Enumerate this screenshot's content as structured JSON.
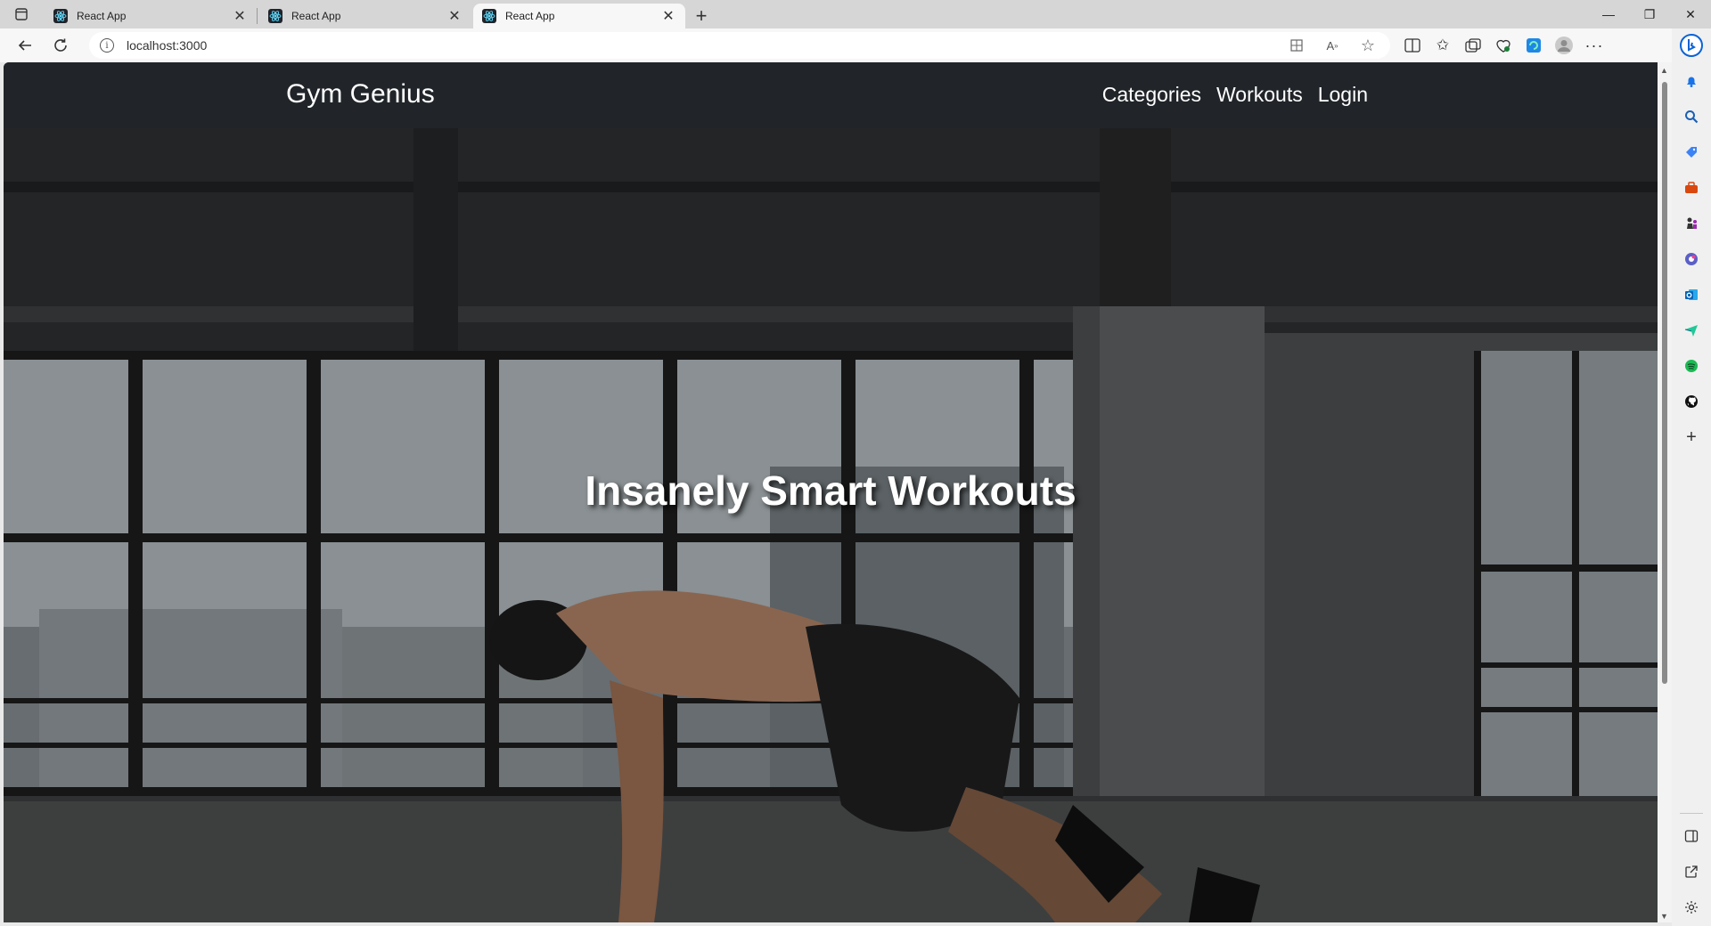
{
  "browser": {
    "tabs": [
      {
        "title": "React App",
        "active": false
      },
      {
        "title": "React App",
        "active": false
      },
      {
        "title": "React App",
        "active": true
      }
    ],
    "url": "localhost:3000"
  },
  "site": {
    "brand": "Gym Genius",
    "nav": [
      "Categories",
      "Workouts",
      "Login"
    ],
    "hero_title": "Insanely Smart Workouts"
  },
  "colors": {
    "navbar_bg": "#212529",
    "hero_text": "#ffffff",
    "react_blue": "#61dafb",
    "edge_blue": "#0a63d6"
  },
  "icons": {
    "sidebar": [
      "bell-icon",
      "search-icon",
      "tag-icon",
      "briefcase-icon",
      "chess-icon",
      "copilot-icon",
      "outlook-icon",
      "send-icon",
      "spotify-icon",
      "github-icon",
      "add-icon"
    ],
    "sidebar_bottom": [
      "panel-icon",
      "external-link-icon",
      "settings-icon"
    ]
  }
}
